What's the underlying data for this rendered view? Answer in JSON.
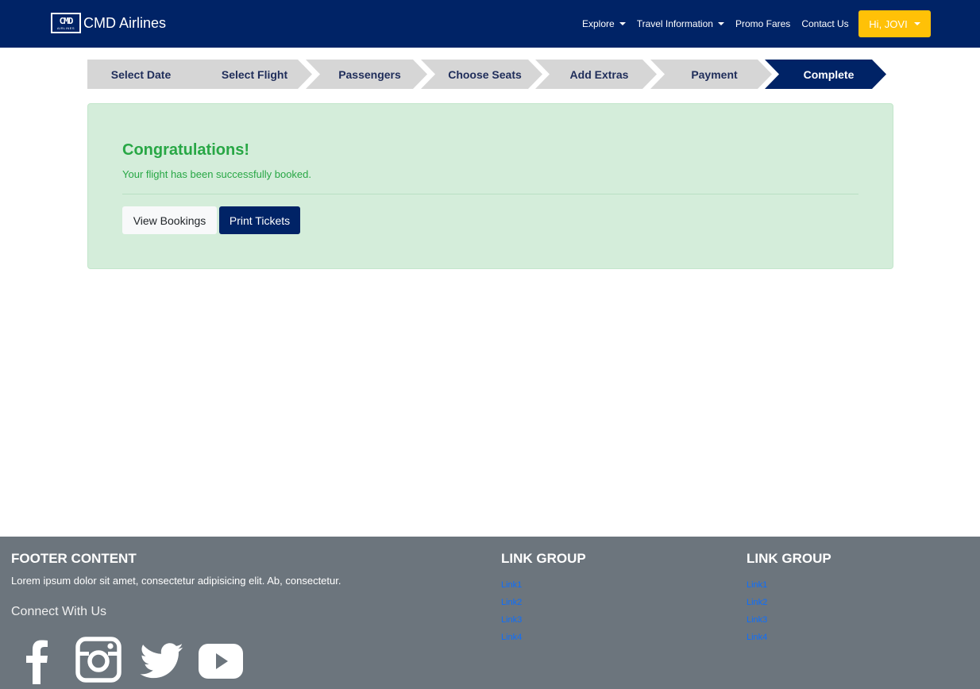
{
  "navbar": {
    "logo_text": "CMD",
    "logo_subtext": "AIRLINES",
    "brand_name": "CMD Airlines",
    "links": [
      {
        "label": "Explore",
        "dropdown": true
      },
      {
        "label": "Travel Information",
        "dropdown": true
      },
      {
        "label": "Promo Fares",
        "dropdown": false
      },
      {
        "label": "Contact Us",
        "dropdown": false
      }
    ],
    "user_button": "Hi, JOVI"
  },
  "stepper": {
    "steps": [
      "Select Date",
      "Select Flight",
      "Passengers",
      "Choose Seats",
      "Add Extras",
      "Payment",
      "Complete"
    ],
    "active": "Complete"
  },
  "alert": {
    "heading": "Congratulations!",
    "message": "Your flight has been successfully booked.",
    "view_bookings": "View Bookings",
    "print_tickets": "Print Tickets"
  },
  "footer": {
    "title": "FOOTER CONTENT",
    "text": "Lorem ipsum dolor sit amet, consectetur adipisicing elit. Ab, consectetur.",
    "connect": "Connect With Us",
    "social_icons": [
      "facebook-icon",
      "instagram-icon",
      "twitter-icon",
      "youtube-icon"
    ],
    "link_groups": [
      {
        "title": "LINK GROUP",
        "links": [
          "Link1",
          "Link2",
          "Link3",
          "Link4"
        ]
      },
      {
        "title": "LINK GROUP",
        "links": [
          "Link1",
          "Link2",
          "Link3",
          "Link4"
        ]
      }
    ]
  },
  "colors": {
    "navy": "#002366",
    "accent_yellow": "#ffc107",
    "success_green": "#28a745",
    "success_bg": "#d4edda",
    "footer_bg": "#6c757d",
    "link_blue": "#0d6efd"
  }
}
